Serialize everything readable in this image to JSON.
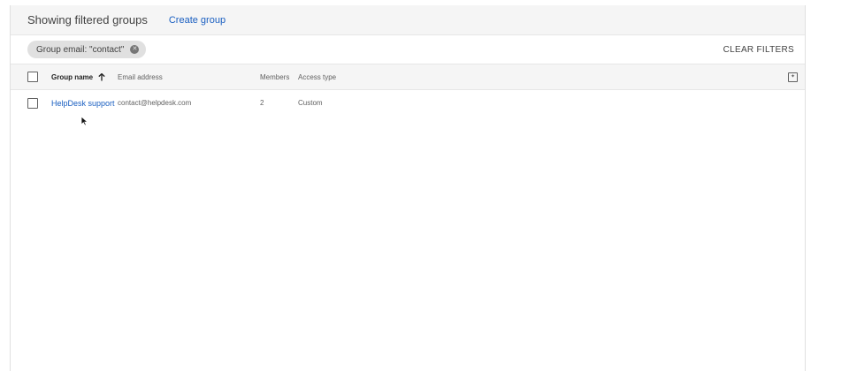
{
  "header": {
    "title": "Showing filtered groups",
    "create_link": "Create group"
  },
  "filters": {
    "chip_label": "Group email: \"contact\"",
    "clear_label": "CLEAR FILTERS"
  },
  "table": {
    "columns": {
      "group_name": "Group name",
      "email": "Email address",
      "members": "Members",
      "access_type": "Access type"
    },
    "sort": {
      "column": "group_name",
      "direction": "ascending"
    },
    "rows": [
      {
        "group_name": "HelpDesk support",
        "email": "contact@helpdesk.com",
        "members": "2",
        "access_type": "Custom"
      }
    ]
  },
  "icons": {
    "chip_close": "close-circle-icon",
    "sort": "arrow-up-icon",
    "column_settings": "column-settings-icon"
  }
}
